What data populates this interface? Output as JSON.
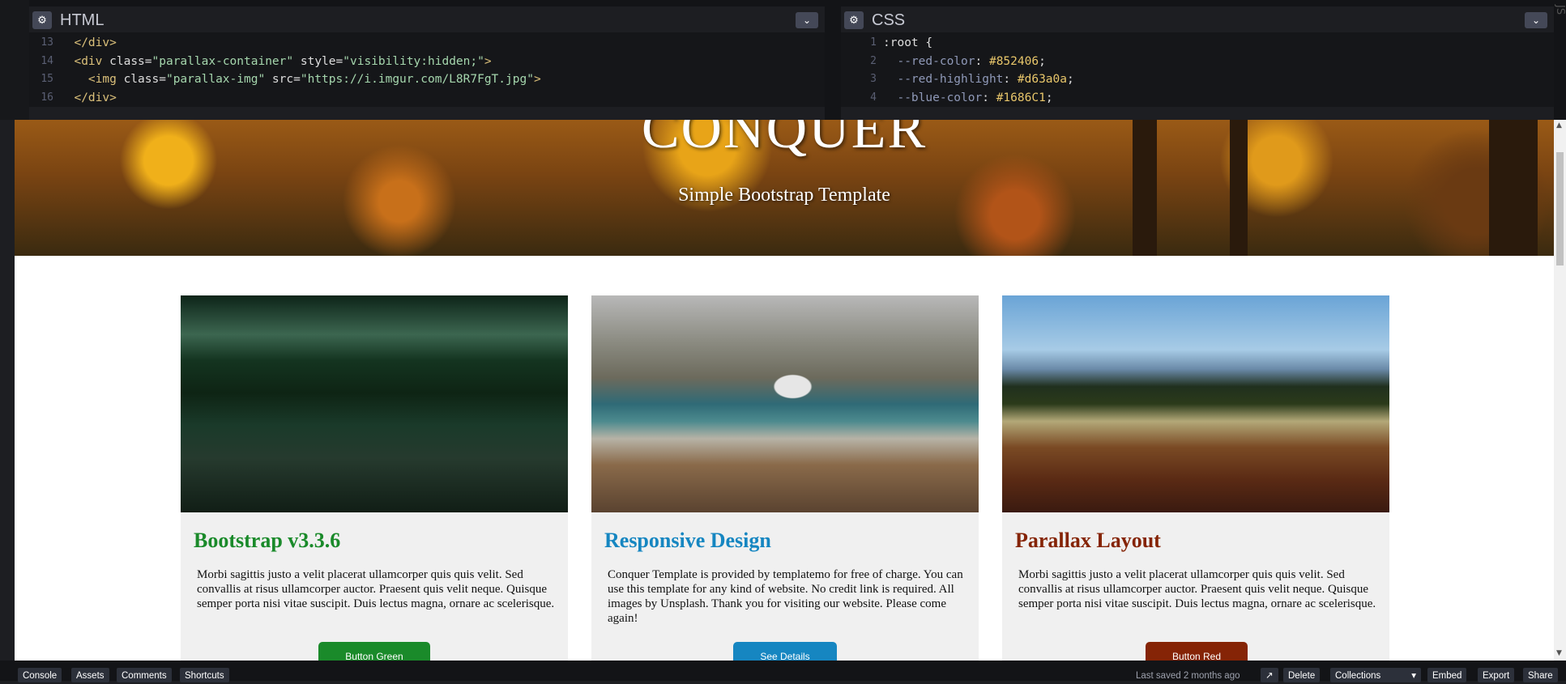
{
  "editor": {
    "html_pane": {
      "title": "HTML",
      "lines": [
        {
          "num": "13",
          "indent": "  ",
          "parts": [
            {
              "t": "</div>",
              "c": "tag"
            }
          ]
        },
        {
          "num": "14",
          "indent": "  ",
          "parts": [
            {
              "t": "<div ",
              "c": "tag"
            },
            {
              "t": "class",
              "c": "attr"
            },
            {
              "t": "=",
              "c": "attr"
            },
            {
              "t": "\"parallax-container\"",
              "c": "str"
            },
            {
              "t": " style",
              "c": "attr"
            },
            {
              "t": "=",
              "c": "attr"
            },
            {
              "t": "\"visibility:hidden;\"",
              "c": "str"
            },
            {
              "t": ">",
              "c": "tag"
            }
          ]
        },
        {
          "num": "15",
          "indent": "    ",
          "parts": [
            {
              "t": "<img ",
              "c": "tag"
            },
            {
              "t": "class",
              "c": "attr"
            },
            {
              "t": "=",
              "c": "attr"
            },
            {
              "t": "\"parallax-img\"",
              "c": "str"
            },
            {
              "t": " src",
              "c": "attr"
            },
            {
              "t": "=",
              "c": "attr"
            },
            {
              "t": "\"https://i.imgur.com/L8R7FgT.jpg\"",
              "c": "str"
            },
            {
              "t": ">",
              "c": "tag"
            }
          ]
        },
        {
          "num": "16",
          "indent": "  ",
          "parts": [
            {
              "t": "</div>",
              "c": "tag"
            }
          ]
        }
      ]
    },
    "css_pane": {
      "title": "CSS",
      "lines": [
        {
          "num": "1",
          "indent": "",
          "parts": [
            {
              "t": ":root {",
              "c": "attr"
            }
          ]
        },
        {
          "num": "2",
          "indent": "  ",
          "parts": [
            {
              "t": "--red-color",
              "c": "prop"
            },
            {
              "t": ": ",
              "c": "attr"
            },
            {
              "t": "#852406",
              "c": "val"
            },
            {
              "t": ";",
              "c": "attr"
            }
          ]
        },
        {
          "num": "3",
          "indent": "  ",
          "parts": [
            {
              "t": "--red-highlight",
              "c": "prop"
            },
            {
              "t": ": ",
              "c": "attr"
            },
            {
              "t": "#d63a0a",
              "c": "val"
            },
            {
              "t": ";",
              "c": "attr"
            }
          ]
        },
        {
          "num": "4",
          "indent": "  ",
          "parts": [
            {
              "t": "--blue-color",
              "c": "prop"
            },
            {
              "t": ": ",
              "c": "attr"
            },
            {
              "t": "#1686C1",
              "c": "val"
            },
            {
              "t": ";",
              "c": "attr"
            }
          ]
        }
      ]
    },
    "js_tab_label": "JS"
  },
  "preview": {
    "hero": {
      "title": "CONQUER",
      "subtitle": "Simple Bootstrap Template"
    },
    "cards": [
      {
        "title": "Bootstrap v3.3.6",
        "title_color": "#1a8a2a",
        "text": "Morbi sagittis justo a velit placerat ullamcorper quis quis velit. Sed convallis at risus ullamcorper auctor. Praesent quis velit neque. Quisque semper porta nisi vitae suscipit. Duis lectus magna, ornare ac scelerisque.",
        "button": "Button Green",
        "button_color": "#1a8a2a"
      },
      {
        "title": "Responsive Design",
        "title_color": "#1686C1",
        "text": "Conquer Template is provided by templatemo for free of charge. You can use this template for any kind of website. No credit link is required. All images by Unsplash. Thank you for visiting our website. Please come again!",
        "button": "See Details",
        "button_color": "#1686C1"
      },
      {
        "title": "Parallax Layout",
        "title_color": "#852406",
        "text": "Morbi sagittis justo a velit placerat ullamcorper quis quis velit. Sed convallis at risus ullamcorper auctor. Praesent quis velit neque. Quisque semper porta nisi vitae suscipit. Duis lectus magna, ornare ac scelerisque.",
        "button": "Button Red",
        "button_color": "#852406"
      }
    ]
  },
  "bottombar": {
    "left": [
      "Console",
      "Assets",
      "Comments",
      "Shortcuts"
    ],
    "saved_text": "Last saved 2 months ago",
    "right": [
      "Delete",
      "Collections",
      "Embed",
      "Export",
      "Share"
    ]
  }
}
